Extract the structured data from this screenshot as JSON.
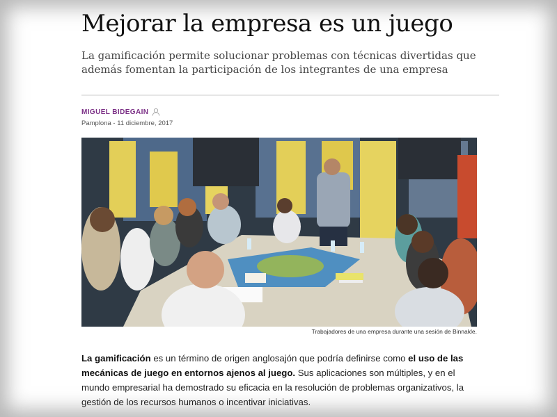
{
  "article": {
    "headline": "Mejorar la empresa es un juego",
    "subtitle": "La gamificación permite solucionar problemas con técnicas divertidas que además fomentan la participación de los integrantes de una empresa",
    "author": "MIGUEL BIDEGAIN",
    "author_icon": "user-outline-icon",
    "location": "Pamplona",
    "date_separator": " - ",
    "date": "11 diciembre, 2017",
    "photo_caption": "Trabajadores de una empresa durante una sesión de Binnakle.",
    "body": {
      "term": "La gamificación",
      "text_1": " es un término de origen anglosajón que podría definirse como ",
      "emphasis": "el uso de las mecánicas de juego en entornos ajenos al juego.",
      "text_2": " Sus aplicaciones son múltiples, y en el mundo empresarial ha demostrado su eficacia en la resolución de problemas organizativos, la gestión de los recursos humanos o incentivar iniciativas."
    }
  },
  "colors": {
    "author": "#7b2f86",
    "headline": "#111111",
    "background": "#ffffff"
  }
}
